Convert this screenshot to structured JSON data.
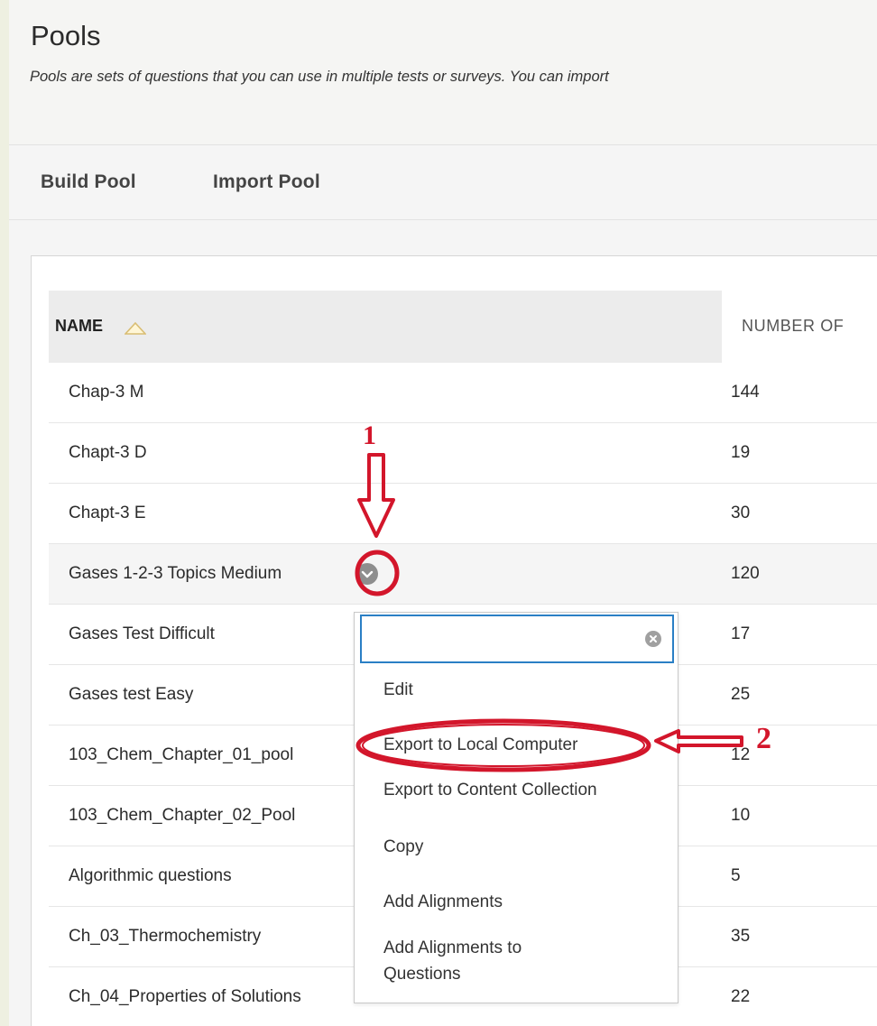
{
  "page": {
    "title": "Pools",
    "description": "Pools are sets of questions that you can use in multiple tests or surveys. You can import"
  },
  "actions": {
    "build_pool": "Build Pool",
    "import_pool": "Import Pool"
  },
  "table": {
    "col_name": "NAME",
    "col_number": "NUMBER OF",
    "rows": [
      {
        "name": "Chap-3 M",
        "count": "144"
      },
      {
        "name": "Chapt-3 D",
        "count": "19"
      },
      {
        "name": "Chapt-3 E",
        "count": "30"
      },
      {
        "name": "Gases 1-2-3 Topics Medium",
        "count": "120"
      },
      {
        "name": "Gases Test Difficult",
        "count": "17"
      },
      {
        "name": "Gases test Easy",
        "count": "25"
      },
      {
        "name": "103_Chem_Chapter_01_pool",
        "count": "12"
      },
      {
        "name": "103_Chem_Chapter_02_Pool",
        "count": "10"
      },
      {
        "name": "Algorithmic questions",
        "count": "5"
      },
      {
        "name": "Ch_03_Thermochemistry",
        "count": "35"
      },
      {
        "name": "Ch_04_Properties of Solutions",
        "count": "22"
      }
    ]
  },
  "menu": {
    "search_value": "",
    "items": [
      "Edit",
      "Export to Local Computer",
      "Export to Content Collection",
      "Copy",
      "Add Alignments",
      "Add Alignments to Questions"
    ]
  },
  "annotations": {
    "step1": "1",
    "step2": "2",
    "color": "#d3162b"
  },
  "colors": {
    "focus_border": "#2a7fc5",
    "chevron_bg": "#8e8e8e"
  },
  "icons": {
    "sort": "sort-ascending-triangle-icon",
    "chevron": "chevron-down-circle-icon",
    "clear": "clear-x-circle-icon"
  }
}
